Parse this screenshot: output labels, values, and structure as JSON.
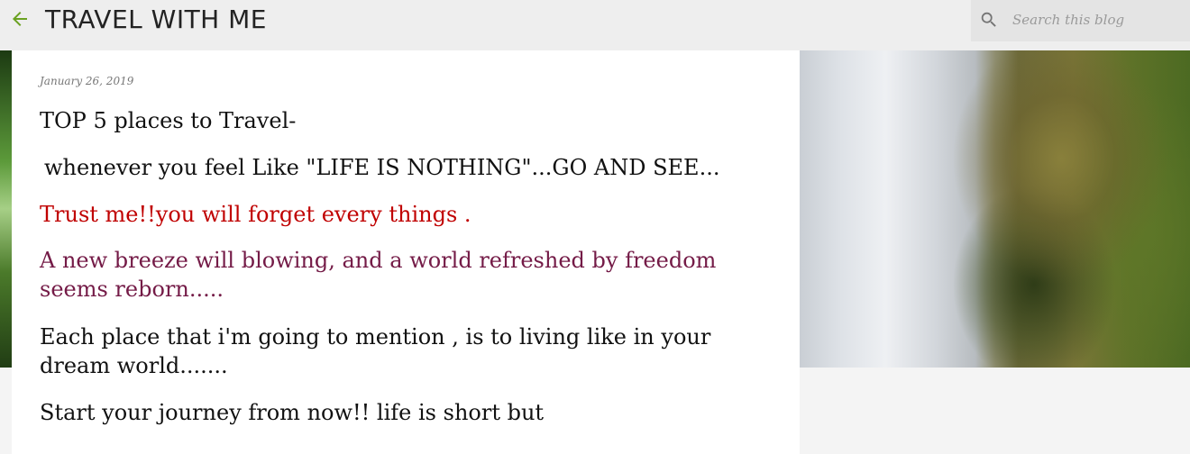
{
  "header": {
    "blog_title": "TRAVEL WITH ME",
    "back_icon": "back-arrow-icon",
    "back_icon_color": "#6aa121"
  },
  "search": {
    "placeholder": "Search this blog",
    "icon": "search-icon"
  },
  "post": {
    "date": "January 26, 2019",
    "lines": [
      "TOP 5 places to Travel-",
      "whenever you feel Like \"LIFE IS NOTHING\"...GO AND SEE...",
      "Trust me!!you will forget every things .",
      "A new breeze will blowing, and a world refreshed by freedom seems reborn.....",
      "Each place that i'm going to mention , is to living like in your dream world.......",
      "Start your journey from now!! life is short but"
    ],
    "colors": {
      "default": "#111111",
      "highlight_red": "#c00000",
      "highlight_purple": "#741b47"
    }
  }
}
